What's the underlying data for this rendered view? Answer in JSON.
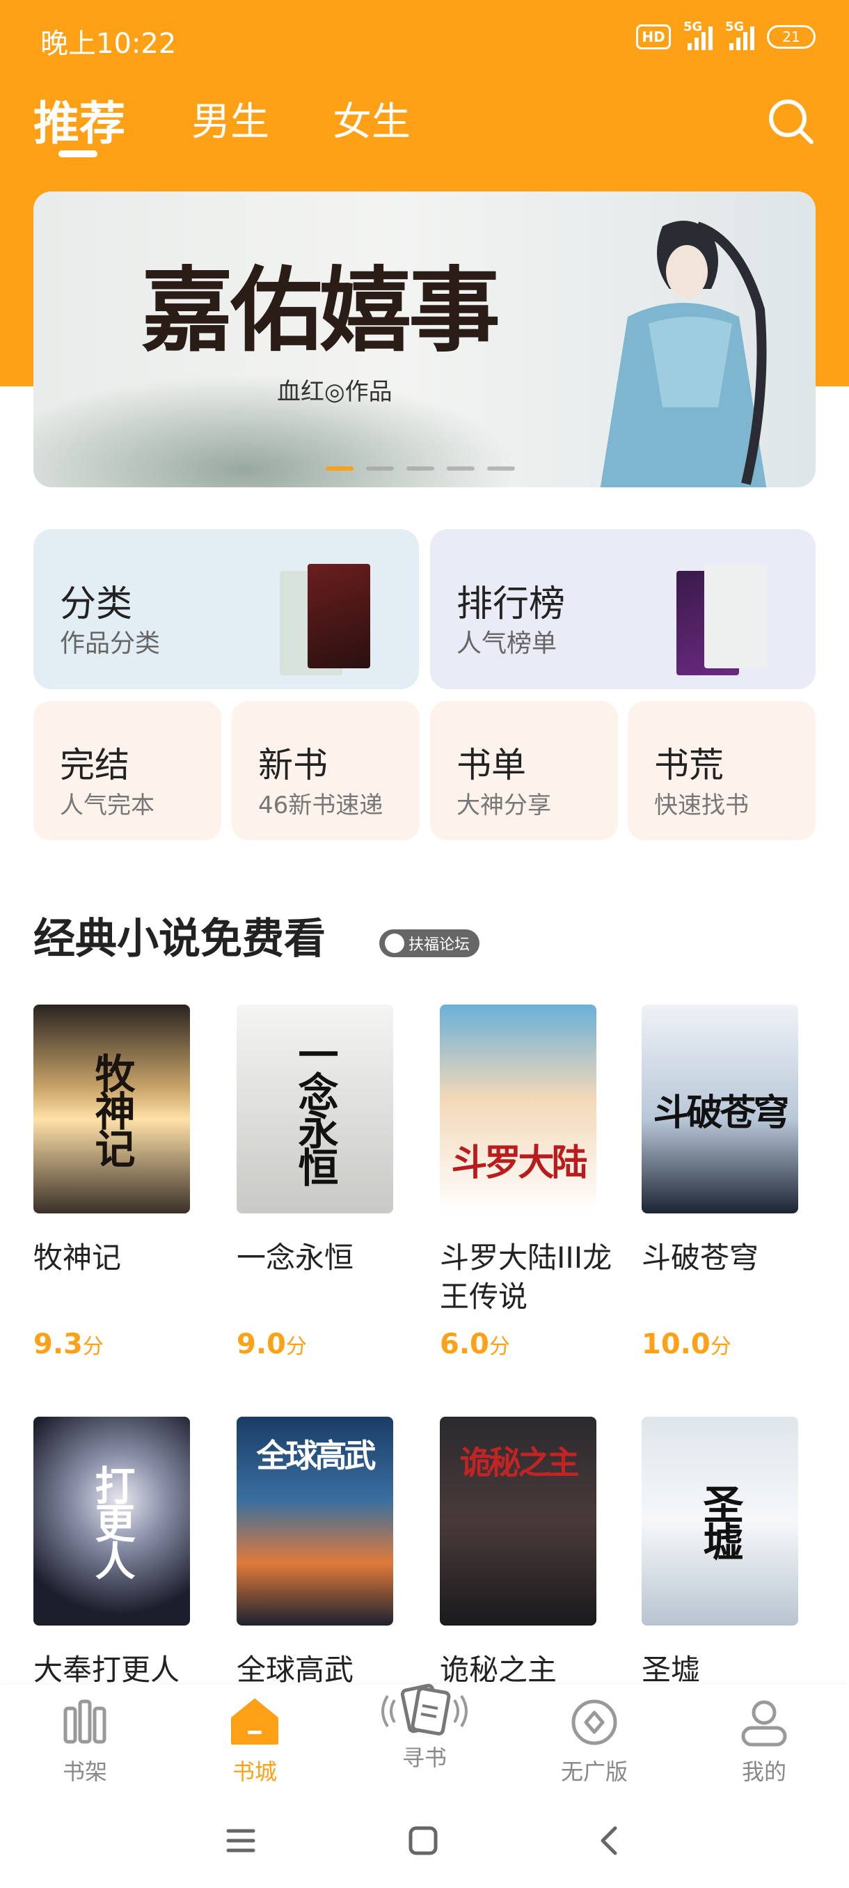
{
  "status_bar": {
    "time": "晚上10:22",
    "hd": "HD",
    "net1": "5G",
    "net2": "5G",
    "battery": "21"
  },
  "top_nav": {
    "tabs": [
      {
        "label": "推荐"
      },
      {
        "label": "男生"
      },
      {
        "label": "女生"
      }
    ],
    "search_icon": "search-icon"
  },
  "banner": {
    "title": "嘉佑嬉事",
    "subtitle": "血红◎作品",
    "pages": 5,
    "active_page": 1
  },
  "categories": {
    "big": [
      {
        "title": "分类",
        "subtitle": "作品分类"
      },
      {
        "title": "排行榜",
        "subtitle": "人气榜单"
      }
    ],
    "small": [
      {
        "title": "完结",
        "subtitle": "人气完本"
      },
      {
        "title": "新书",
        "subtitle": "46新书速递"
      },
      {
        "title": "书单",
        "subtitle": "大神分享"
      },
      {
        "title": "书荒",
        "subtitle": "快速找书"
      }
    ]
  },
  "section": {
    "title": "经典小说免费看",
    "watermark": "扶福论坛"
  },
  "books": [
    {
      "title": "牧神记",
      "score": "9.3",
      "unit": "分",
      "cover_text": "牧神记"
    },
    {
      "title": "一念永恒",
      "score": "9.0",
      "unit": "分",
      "cover_text": "一念永恒"
    },
    {
      "title": "斗罗大陆III龙王传说",
      "score": "6.0",
      "unit": "分",
      "cover_text": "斗罗大陆"
    },
    {
      "title": "斗破苍穹",
      "score": "10.0",
      "unit": "分",
      "cover_text": "斗破苍穹"
    },
    {
      "title": "大奉打更人",
      "cover_text": "打更人"
    },
    {
      "title": "全球高武",
      "cover_text": "全球高武"
    },
    {
      "title": "诡秘之主",
      "cover_text": "诡秘之主"
    },
    {
      "title": "圣墟",
      "cover_text": "圣墟"
    }
  ],
  "bottom_nav": [
    {
      "label": "书架",
      "icon": "bookshelf-icon"
    },
    {
      "label": "书城",
      "icon": "home-icon"
    },
    {
      "label": "寻书",
      "icon": "find-book-icon"
    },
    {
      "label": "无广版",
      "icon": "ad-free-icon"
    },
    {
      "label": "我的",
      "icon": "profile-icon"
    }
  ],
  "colors": {
    "accent": "#ffa117",
    "card_blue": "#e3eef4",
    "card_lilac": "#e9ebf6",
    "card_peach": "#fdf3ec"
  }
}
